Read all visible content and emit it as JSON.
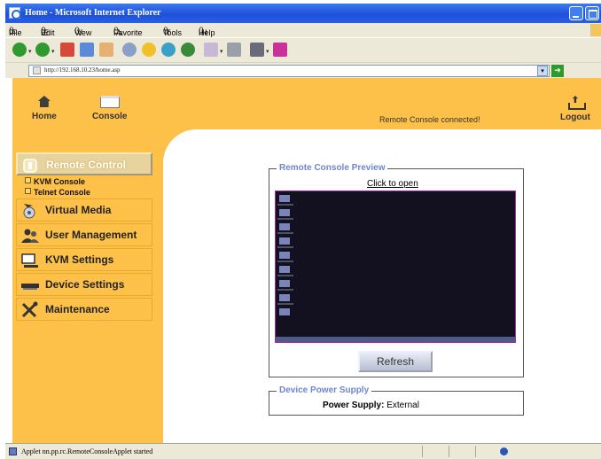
{
  "browser": {
    "title": "Home - Microsoft Internet Explorer",
    "menu": [
      "File",
      "Edit",
      "View",
      "Favorite",
      "Tools",
      "Help"
    ],
    "menu_keys": [
      "F",
      "E",
      "V",
      "A",
      "T",
      "H"
    ],
    "address": "http://192.168.10.23/home.asp",
    "status_text": "Applet nn.pp.rc.RemoteConsoleApplet started"
  },
  "nav": {
    "home_label": "Home",
    "console_label": "Console",
    "logout_label": "Logout",
    "connection_status": "Remote Console connected!"
  },
  "sidebar": {
    "remote_control_label": "Remote Control",
    "sub_links": [
      "KVM Console",
      "Telnet Console"
    ],
    "items": [
      {
        "label": "Virtual Media",
        "icon": "virtual-media-icon"
      },
      {
        "label": "User Management",
        "icon": "users-icon"
      },
      {
        "label": "KVM Settings",
        "icon": "kvm-icon"
      },
      {
        "label": "Device Settings",
        "icon": "device-icon"
      },
      {
        "label": "Maintenance",
        "icon": "tools-icon"
      }
    ]
  },
  "preview": {
    "legend": "Remote Console Preview",
    "open_link": "Click to open",
    "refresh_label": "Refresh"
  },
  "power": {
    "legend": "Device Power Supply",
    "label": "Power Supply:",
    "value": "External"
  },
  "colors": {
    "page_bg": "#fdc149",
    "legend_text": "#6e86d0",
    "preview_border": "#a02aa8"
  }
}
